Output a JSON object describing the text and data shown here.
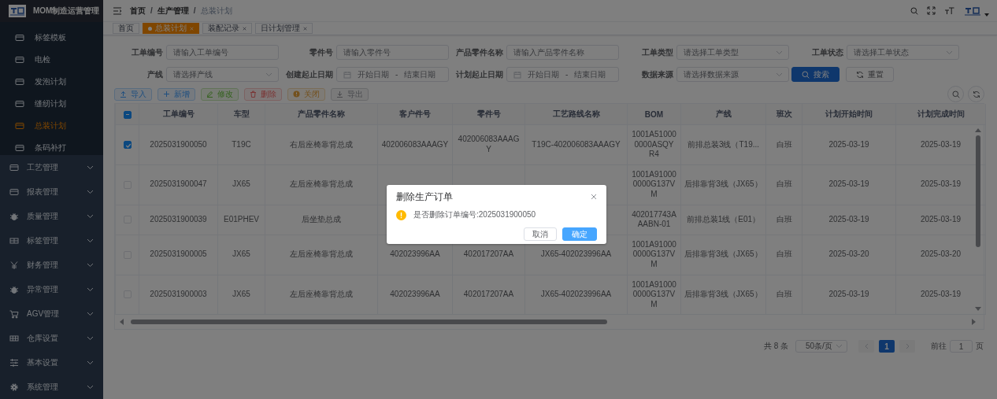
{
  "app": {
    "title": "MOM制造运营管理"
  },
  "sidebar": {
    "subitems": [
      {
        "label": "标签模板",
        "selected": false
      },
      {
        "label": "电检",
        "selected": false
      },
      {
        "label": "发泡计划",
        "selected": false
      },
      {
        "label": "缝纫计划",
        "selected": false
      },
      {
        "label": "总装计划",
        "selected": true
      },
      {
        "label": "条码补打",
        "selected": false
      }
    ],
    "menus": [
      {
        "label": "工艺管理"
      },
      {
        "label": "报表管理"
      },
      {
        "label": "质量管理"
      },
      {
        "label": "标签管理"
      },
      {
        "label": "财务管理"
      },
      {
        "label": "异常管理"
      },
      {
        "label": "AGV管理"
      },
      {
        "label": "仓库设置"
      },
      {
        "label": "基本设置"
      },
      {
        "label": "系统管理"
      }
    ]
  },
  "header": {
    "breadcrumb": [
      "首页",
      "生产管理",
      "总装计划"
    ],
    "separator": "/"
  },
  "tags": [
    {
      "label": "首页",
      "selected": false,
      "closable": false
    },
    {
      "label": "总装计划",
      "selected": true,
      "closable": true
    },
    {
      "label": "装配记录",
      "selected": false,
      "closable": true
    },
    {
      "label": "日计划管理",
      "selected": false,
      "closable": true
    }
  ],
  "filters": {
    "rows": [
      {
        "fields": [
          {
            "kind": "text",
            "label": "工单编号",
            "placeholder": "请输入工单编号"
          },
          {
            "kind": "text",
            "label": "零件号",
            "placeholder": "请输入零件号"
          },
          {
            "kind": "text",
            "label": "产品零件名称",
            "placeholder": "请输入产品零件名称"
          },
          {
            "kind": "select",
            "label": "工单类型",
            "placeholder": "请选择工单类型"
          },
          {
            "kind": "select",
            "label": "工单状态",
            "placeholder": "请选择工单状态"
          }
        ]
      },
      {
        "fields": [
          {
            "kind": "select",
            "label": "产线",
            "placeholder": "请选择产线"
          },
          {
            "kind": "daterange",
            "label": "创建起止日期",
            "start_placeholder": "开始日期",
            "separator": "-",
            "end_placeholder": "结束日期"
          },
          {
            "kind": "daterange",
            "label": "计划起止日期",
            "start_placeholder": "开始日期",
            "separator": "-",
            "end_placeholder": "结束日期"
          },
          {
            "kind": "select",
            "label": "数据来源",
            "placeholder": "请选择数据来源"
          }
        ],
        "buttons": [
          {
            "kind": "search",
            "label": "搜索"
          },
          {
            "kind": "reset",
            "label": "重置"
          }
        ]
      }
    ]
  },
  "toolbar": {
    "buttons": [
      {
        "kind": "import",
        "label": "导入"
      },
      {
        "kind": "add",
        "label": "新增"
      },
      {
        "kind": "edit",
        "label": "修改"
      },
      {
        "kind": "delete",
        "label": "删除"
      },
      {
        "kind": "close",
        "label": "关闭"
      },
      {
        "kind": "export",
        "label": "导出"
      }
    ]
  },
  "table": {
    "select_all_indeterminate": true,
    "columns": [
      "工单编号",
      "车型",
      "产品零件名称",
      "客户件号",
      "零件号",
      "工艺路线名称",
      "BOM",
      "产线",
      "班次",
      "计划开始时间",
      "计划完成时间"
    ],
    "rows": [
      {
        "checked": true,
        "cells": [
          "2025031900050",
          "T19C",
          "右后座椅靠背总成",
          "402006083AAAGY",
          "402006083AAAGY",
          "T19C-402006083AAAGY",
          "1001A510000000ASQYR4",
          "前排总装3线（T19...",
          "白班",
          "2025-03-19",
          "2025-03-19"
        ]
      },
      {
        "checked": false,
        "cells": [
          "2025031900047",
          "JX65",
          "左后座椅靠背总成",
          null,
          null,
          null,
          "1001A910000000G137VM",
          "后排靠背3线（JX65）",
          "白班",
          "2025-03-19",
          "2025-03-19"
        ]
      },
      {
        "checked": false,
        "cells": [
          "2025031900039",
          "E01PHEV",
          "后坐垫总成",
          null,
          null,
          null,
          "402017743AAABN-01",
          "前排总装1线（E01）",
          "白班",
          "2025-03-19",
          "2025-03-19"
        ]
      },
      {
        "checked": false,
        "cells": [
          "2025031900005",
          "JX65",
          "左后座椅靠背总成",
          "402023996AA",
          "402017207AA",
          "JX65-402023996AA",
          "1001A910000000G137VM",
          "后排靠背3线（JX65）",
          "白班",
          "2025-03-20",
          "2025-03-20"
        ]
      },
      {
        "checked": false,
        "cells": [
          "2025031900003",
          "JX65",
          "左后座椅靠背总成",
          "402023996AA",
          "402017207AA",
          "JX65-402023996AA",
          "1001A910000000G137VM",
          "后排靠背3线（JX65）",
          "白班",
          "2025-03-19",
          "2025-03-19"
        ]
      }
    ]
  },
  "pagination": {
    "total": "共 8 条",
    "page_size": "50条/页",
    "pages": [
      {
        "label": "1",
        "selected": true
      }
    ],
    "jump_label": "前往",
    "jump_value": "1",
    "jump_suffix": "页"
  },
  "dialog": {
    "title": "删除生产订单",
    "message": "是否删除订单编号:2025031900050",
    "buttons": [
      {
        "kind": "cancel",
        "label": "取消"
      },
      {
        "kind": "primary",
        "label": "确定"
      }
    ]
  }
}
